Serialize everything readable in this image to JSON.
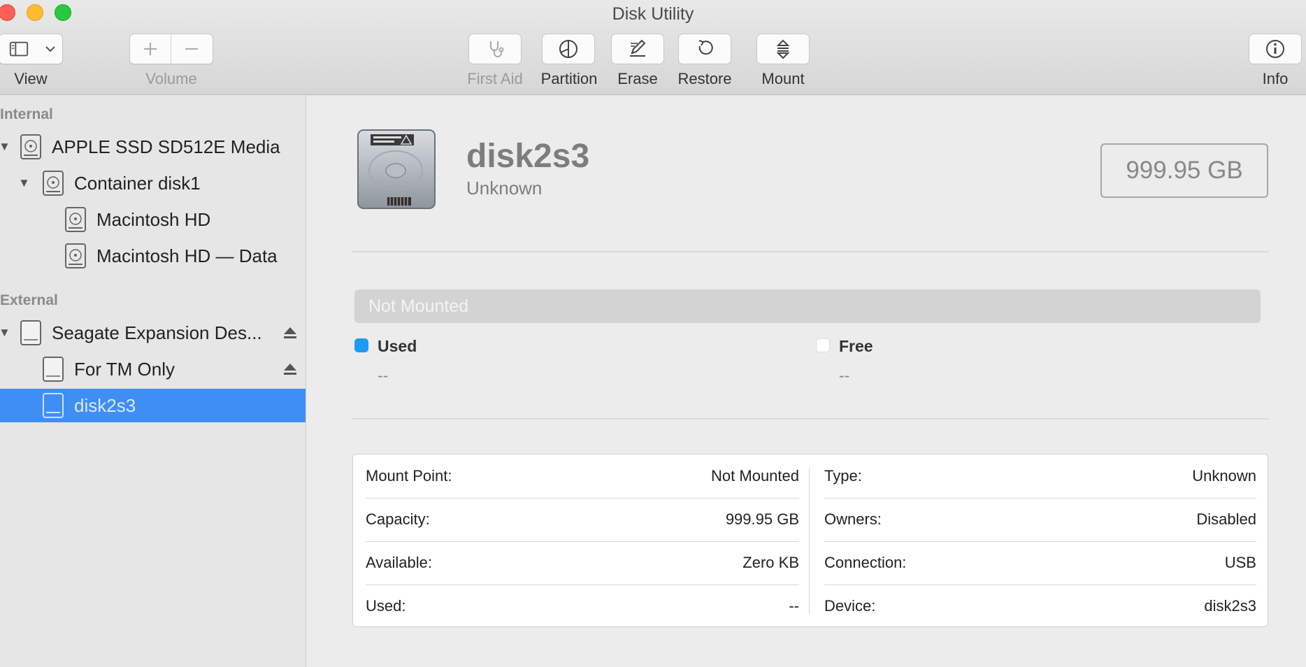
{
  "window": {
    "title": "Disk Utility"
  },
  "toolbar": {
    "view_label": "View",
    "volume_label": "Volume",
    "first_aid_label": "First Aid",
    "partition_label": "Partition",
    "erase_label": "Erase",
    "restore_label": "Restore",
    "mount_label": "Mount",
    "info_label": "Info"
  },
  "sidebar": {
    "internal_header": "Internal",
    "external_header": "External",
    "internal_items": [
      {
        "label": "APPLE SSD SD512E Media"
      },
      {
        "label": "Container disk1"
      },
      {
        "label": "Macintosh HD"
      },
      {
        "label": "Macintosh HD — Data"
      }
    ],
    "external_items": [
      {
        "label": "Seagate Expansion Des..."
      },
      {
        "label": "For TM Only"
      },
      {
        "label": "disk2s3"
      }
    ]
  },
  "detail": {
    "name": "disk2s3",
    "subtitle": "Unknown",
    "capacity": "999.95 GB",
    "usage_bar_text": "Not Mounted",
    "used_label": "Used",
    "used_value": "--",
    "free_label": "Free",
    "free_value": "--",
    "used_color": "#1e9bf0",
    "info_left": [
      {
        "key": "Mount Point:",
        "value": "Not Mounted"
      },
      {
        "key": "Capacity:",
        "value": "999.95 GB"
      },
      {
        "key": "Available:",
        "value": "Zero KB"
      },
      {
        "key": "Used:",
        "value": "--"
      }
    ],
    "info_right": [
      {
        "key": "Type:",
        "value": "Unknown"
      },
      {
        "key": "Owners:",
        "value": "Disabled"
      },
      {
        "key": "Connection:",
        "value": "USB"
      },
      {
        "key": "Device:",
        "value": "disk2s3"
      }
    ]
  },
  "colors": {
    "selection": "#3f8ef4"
  }
}
